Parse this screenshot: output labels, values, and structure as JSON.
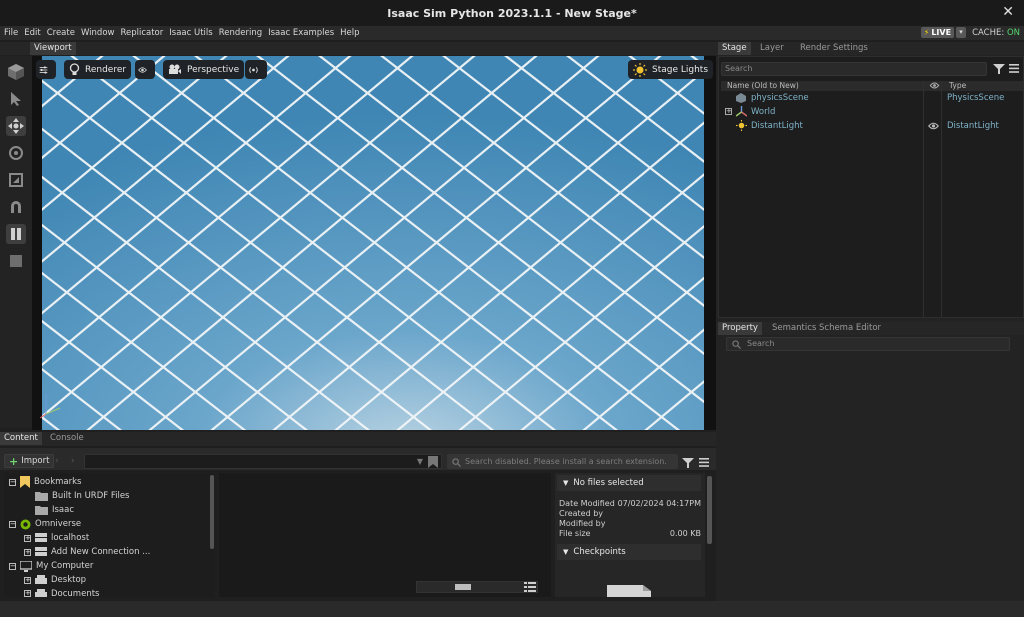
{
  "window": {
    "title": "Isaac Sim Python 2023.1.1 - New Stage*",
    "close_glyph": "✕"
  },
  "menu": [
    "File",
    "Edit",
    "Create",
    "Window",
    "Replicator",
    "Isaac Utils",
    "Rendering",
    "Isaac Examples",
    "Help"
  ],
  "live": {
    "label": "LIVE",
    "cache_label": "CACHE:",
    "cache_state": "ON"
  },
  "viewport": {
    "tab": "Viewport",
    "renderer_label": "Renderer",
    "camera_label": "Perspective",
    "lights_label": "Stage Lights",
    "sky_color": "#4e93be"
  },
  "stage": {
    "tabs": [
      "Stage",
      "Layer",
      "Render Settings"
    ],
    "search_placeholder": "Search",
    "col_name": "Name (Old to New)",
    "col_type": "Type",
    "items": [
      {
        "name": "physicsScene",
        "type": "PhysicsScene",
        "icon": "physics-scene-icon"
      },
      {
        "name": "World",
        "type": "",
        "icon": "xform-icon"
      },
      {
        "name": "DistantLight",
        "type": "DistantLight",
        "icon": "light-icon"
      }
    ]
  },
  "property": {
    "tabs": [
      "Property",
      "Semantics Schema Editor"
    ],
    "search_placeholder": "Search"
  },
  "content": {
    "tabs": [
      "Content",
      "Console"
    ],
    "import_label": "Import",
    "search_placeholder": "Search disabled. Please install a search extension.",
    "tree": [
      {
        "label": "Bookmarks",
        "level": 0,
        "icon": "bookmark-icon",
        "expander": "−"
      },
      {
        "label": "Built In URDF Files",
        "level": 1,
        "icon": "folder-icon",
        "expander": ""
      },
      {
        "label": "Isaac",
        "level": 1,
        "icon": "folder-icon",
        "expander": ""
      },
      {
        "label": "Omniverse",
        "level": 0,
        "icon": "omniverse-icon",
        "expander": "−"
      },
      {
        "label": "localhost",
        "level": 1,
        "icon": "server-icon",
        "expander": "+"
      },
      {
        "label": "Add New Connection ...",
        "level": 1,
        "icon": "server-icon",
        "expander": "+"
      },
      {
        "label": "My Computer",
        "level": 0,
        "icon": "computer-icon",
        "expander": "−"
      },
      {
        "label": "Desktop",
        "level": 1,
        "icon": "drive-icon",
        "expander": "+"
      },
      {
        "label": "Documents",
        "level": 1,
        "icon": "drive-icon",
        "expander": "+"
      }
    ],
    "info": {
      "header": "No files selected",
      "date_modified_label": "Date Modified",
      "date_modified_value": "07/02/2024 04:17PM",
      "created_by_label": "Created by",
      "modified_by_label": "Modified by",
      "file_size_label": "File size",
      "file_size_value": "0.00 KB",
      "checkpoints_label": "Checkpoints"
    }
  }
}
